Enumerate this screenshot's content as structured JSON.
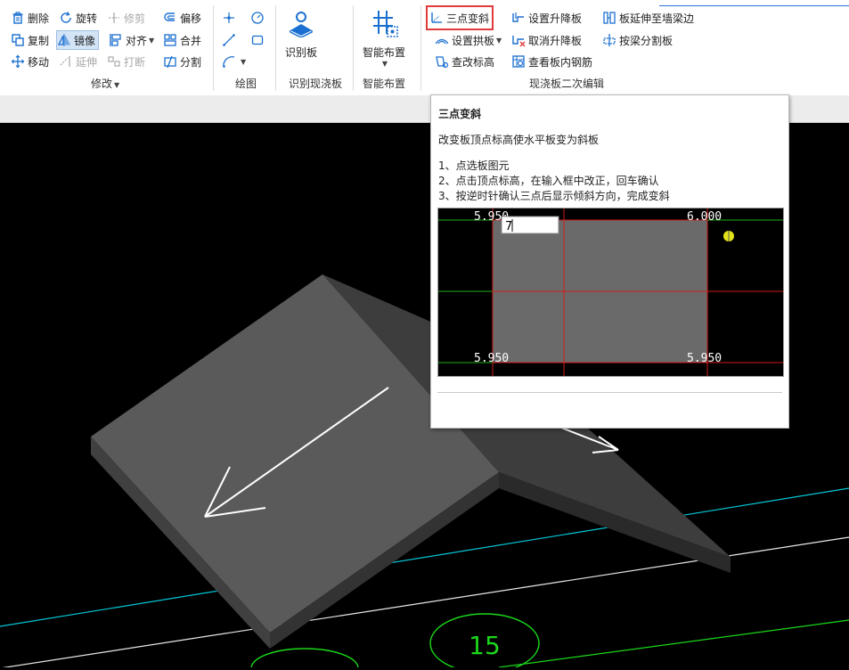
{
  "ribbon": {
    "modify": {
      "delete": "删除",
      "rotate": "旋转",
      "trim": "修剪",
      "offset": "偏移",
      "copy": "复制",
      "mirror": "镜像",
      "align": "对齐",
      "merge": "合并",
      "move": "移动",
      "extend": "延伸",
      "break": "打断",
      "split": "分割",
      "label": "修改"
    },
    "draw": {
      "label": "绘图"
    },
    "recognize": {
      "button": "识别板",
      "label": "识别现浇板"
    },
    "smart": {
      "button": "智能布置",
      "label": "智能布置"
    },
    "edit": {
      "three_point_slope": "三点变斜",
      "set_lift": "设置升降板",
      "extend_to_wall": "板延伸至墙梁边",
      "set_arch": "设置拱板",
      "cancel_lift": "取消升降板",
      "split_by_beam": "按梁分割板",
      "check_elev": "查改标高",
      "view_rebar": "查看板内钢筋",
      "label": "现浇板二次编辑"
    }
  },
  "tooltip": {
    "title": "三点变斜",
    "desc": "改变板顶点标高使水平板变为斜板",
    "steps": [
      "1、点选板图元",
      "2、点击顶点标高，在输入框中改正，回车确认",
      "3、按逆时针确认三点后显示倾斜方向，完成变斜"
    ],
    "preview": {
      "tl": "5.950",
      "tr": "6.000",
      "bl": "5.950",
      "br": "5.950",
      "input": "7"
    }
  },
  "canvas": {
    "axis_label": "15"
  },
  "colors": {
    "accent": "#1a6fd0",
    "highlight": "#e03a3a",
    "slab": "#5a5a5a",
    "cyan": "#00c8d8",
    "green": "#1bd81b"
  }
}
